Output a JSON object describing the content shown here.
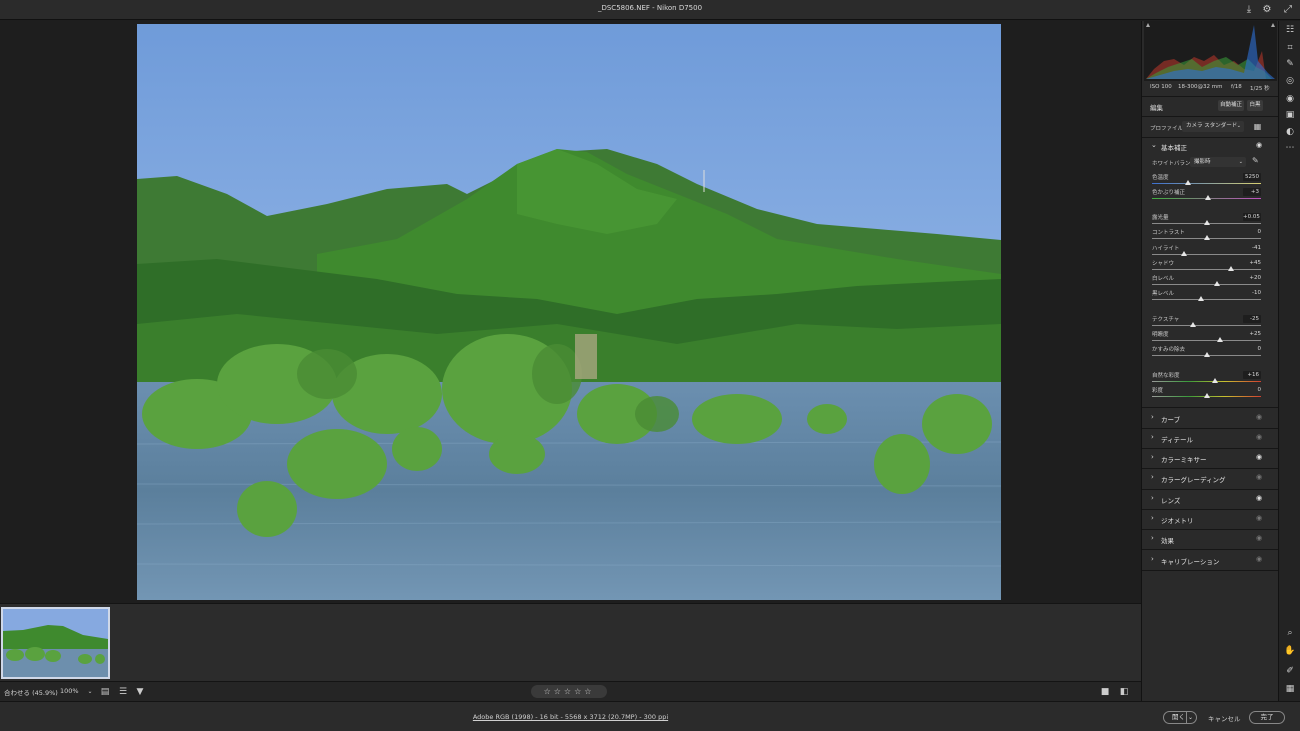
{
  "titlebar": {
    "title": "_DSC5806.NEF  -  Nikon D7500",
    "icons": [
      "save-icon",
      "settings-icon",
      "expand-icon"
    ]
  },
  "camera_info": {
    "iso": "ISO 100",
    "lens": "18-300@32 mm",
    "aperture": "f/18",
    "shutter": "1/25 秒"
  },
  "edit": {
    "title": "編集",
    "auto_label": "自動補正",
    "bw_label": "白黒"
  },
  "profile": {
    "label": "プロファイル",
    "value": "カメラ スタンダード"
  },
  "basic": {
    "title": "基本補正",
    "wb_label": "ホワイトバランス",
    "wb_value": "撮影時",
    "sliders": [
      {
        "label": "色温度",
        "value": "5250",
        "pos": 0.33
      },
      {
        "label": "色かぶり補正",
        "value": "+3",
        "pos": 0.51
      },
      {
        "label": "露光量",
        "value": "+0.05",
        "pos": 0.505
      },
      {
        "label": "コントラスト",
        "value": "0",
        "pos": 0.5
      },
      {
        "label": "ハイライト",
        "value": "-41",
        "pos": 0.295
      },
      {
        "label": "シャドウ",
        "value": "+45",
        "pos": 0.725
      },
      {
        "label": "白レベル",
        "value": "+20",
        "pos": 0.6
      },
      {
        "label": "黒レベル",
        "value": "-10",
        "pos": 0.45
      },
      {
        "label": "テクスチャ",
        "value": "-25",
        "pos": 0.375
      },
      {
        "label": "明瞭度",
        "value": "+25",
        "pos": 0.625
      },
      {
        "label": "かすみの除去",
        "value": "0",
        "pos": 0.5
      },
      {
        "label": "自然な彩度",
        "value": "+16",
        "pos": 0.58
      },
      {
        "label": "彩度",
        "value": "0",
        "pos": 0.5
      }
    ]
  },
  "sections": [
    {
      "label": "カーブ",
      "eye_on": false
    },
    {
      "label": "ディテール",
      "eye_on": false
    },
    {
      "label": "カラーミキサー",
      "eye_on": true
    },
    {
      "label": "カラーグレーディング",
      "eye_on": false
    },
    {
      "label": "レンズ",
      "eye_on": true
    },
    {
      "label": "ジオメトリ",
      "eye_on": false
    },
    {
      "label": "効果",
      "eye_on": false
    },
    {
      "label": "キャリブレーション",
      "eye_on": false
    }
  ],
  "bottombar": {
    "zoom_label": "合わせる (45.9%)",
    "zoom_100": "100%",
    "stars": "☆☆☆☆☆"
  },
  "status": {
    "info": "Adobe RGB (1998) - 16 bit - 5568 x 3712 (20.7MP) - 300 ppi",
    "open_label": "開く",
    "cancel_label": "キャンセル",
    "done_label": "完了"
  },
  "colors": {
    "accent": "#2d8cff",
    "panel_bg": "#2a2a2a"
  }
}
